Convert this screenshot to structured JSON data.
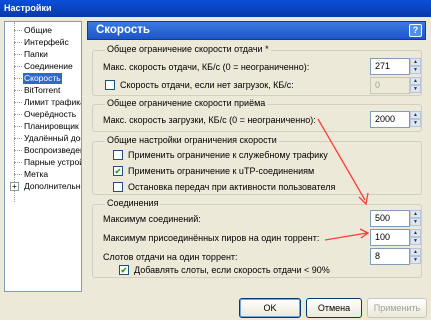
{
  "window": {
    "title": "Настройки"
  },
  "sidebar": {
    "items": [
      {
        "label": "Общие"
      },
      {
        "label": "Интерфейс"
      },
      {
        "label": "Папки"
      },
      {
        "label": "Соединение"
      },
      {
        "label": "Скорость",
        "selected": true
      },
      {
        "label": "BitTorrent"
      },
      {
        "label": "Лимит трафика"
      },
      {
        "label": "Очерёдность"
      },
      {
        "label": "Планировщик"
      },
      {
        "label": "Удалённый досту"
      },
      {
        "label": "Воспроизведение"
      },
      {
        "label": "Парные устройст"
      },
      {
        "label": "Метка"
      },
      {
        "label": "Дополнительно",
        "expandable": true,
        "expander": "+"
      }
    ]
  },
  "header": {
    "title": "Скорость",
    "help_icon": "?"
  },
  "upload_group": {
    "label": "Общее ограничение скорости отдачи *",
    "max_upload_label": "Макс. скорость отдачи, КБ/с (0 = неограниченно):",
    "max_upload_value": "271",
    "alt_upload_label": "Скорость отдачи, если нет загрузок, КБ/с:",
    "alt_upload_checked": false,
    "alt_upload_value": "0"
  },
  "download_group": {
    "label": "Общее ограничение скорости приёма",
    "max_download_label": "Макс. скорость загрузки, КБ/с (0 = неограниченно):",
    "max_download_value": "2000"
  },
  "general_group": {
    "label": "Общие настройки ограничения скорости",
    "options": [
      {
        "label": "Применить ограничение к служебному трафику",
        "checked": false
      },
      {
        "label": "Применить ограничение к uTP-соединениям",
        "checked": true
      },
      {
        "label": "Остановка передач при активности пользователя",
        "checked": false
      }
    ]
  },
  "connections_group": {
    "label": "Соединения",
    "max_connections_label": "Максимум соединений:",
    "max_connections_value": "500",
    "max_peers_label": "Максимум присоединённых пиров на один торрент:",
    "max_peers_value": "100",
    "upload_slots_label": "Слотов отдачи на один торрент:",
    "upload_slots_value": "8",
    "extra_slots_label": "Добавлять слоты, если скорость отдачи < 90%",
    "extra_slots_checked": true
  },
  "buttons": {
    "ok": "OK",
    "cancel": "Отмена",
    "apply": "Применить"
  },
  "colors": {
    "accent": "#316ac5",
    "annotation_arrow": "#ff3b3b"
  }
}
